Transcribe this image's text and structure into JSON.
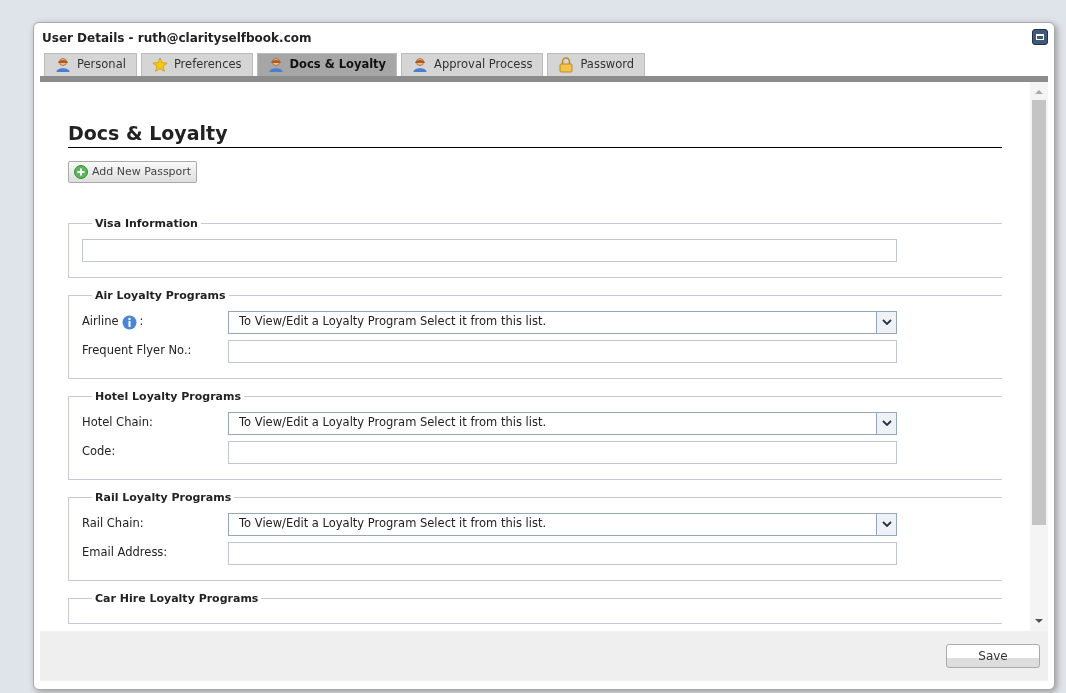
{
  "window": {
    "title": "User Details - ruth@clarityselfbook.com"
  },
  "tabs": [
    {
      "label": "Personal",
      "kind": "person",
      "selected": false
    },
    {
      "label": "Preferences",
      "kind": "star",
      "selected": false
    },
    {
      "label": "Docs & Loyalty",
      "kind": "person",
      "selected": true
    },
    {
      "label": "Approval Process",
      "kind": "person",
      "selected": false
    },
    {
      "label": "Password",
      "kind": "lock",
      "selected": false
    }
  ],
  "heading": "Docs & Loyalty",
  "add_button": "Add New Passport",
  "sections": [
    {
      "legend": "Visa Information",
      "fields": [
        {
          "kind": "input"
        }
      ]
    },
    {
      "legend": "Air Loyalty Programs",
      "fields": [
        {
          "kind": "select",
          "label": "Airline",
          "info": true,
          "label_suffix": ":",
          "value": "To View/Edit a Loyalty Program Select it from this list."
        },
        {
          "kind": "input",
          "label": "Frequent Flyer No.:"
        }
      ]
    },
    {
      "legend": "Hotel Loyalty Programs",
      "fields": [
        {
          "kind": "select",
          "label": "Hotel Chain:",
          "value": "To View/Edit a Loyalty Program Select it from this list."
        },
        {
          "kind": "input",
          "label": "Code:"
        }
      ]
    },
    {
      "legend": "Rail Loyalty Programs",
      "fields": [
        {
          "kind": "select",
          "label": "Rail Chain:",
          "value": "To View/Edit a Loyalty Program Select it from this list."
        },
        {
          "kind": "input",
          "label": "Email Address:"
        }
      ]
    },
    {
      "legend": "Car Hire Loyalty Programs"
    }
  ],
  "footer": {
    "save": "Save"
  }
}
